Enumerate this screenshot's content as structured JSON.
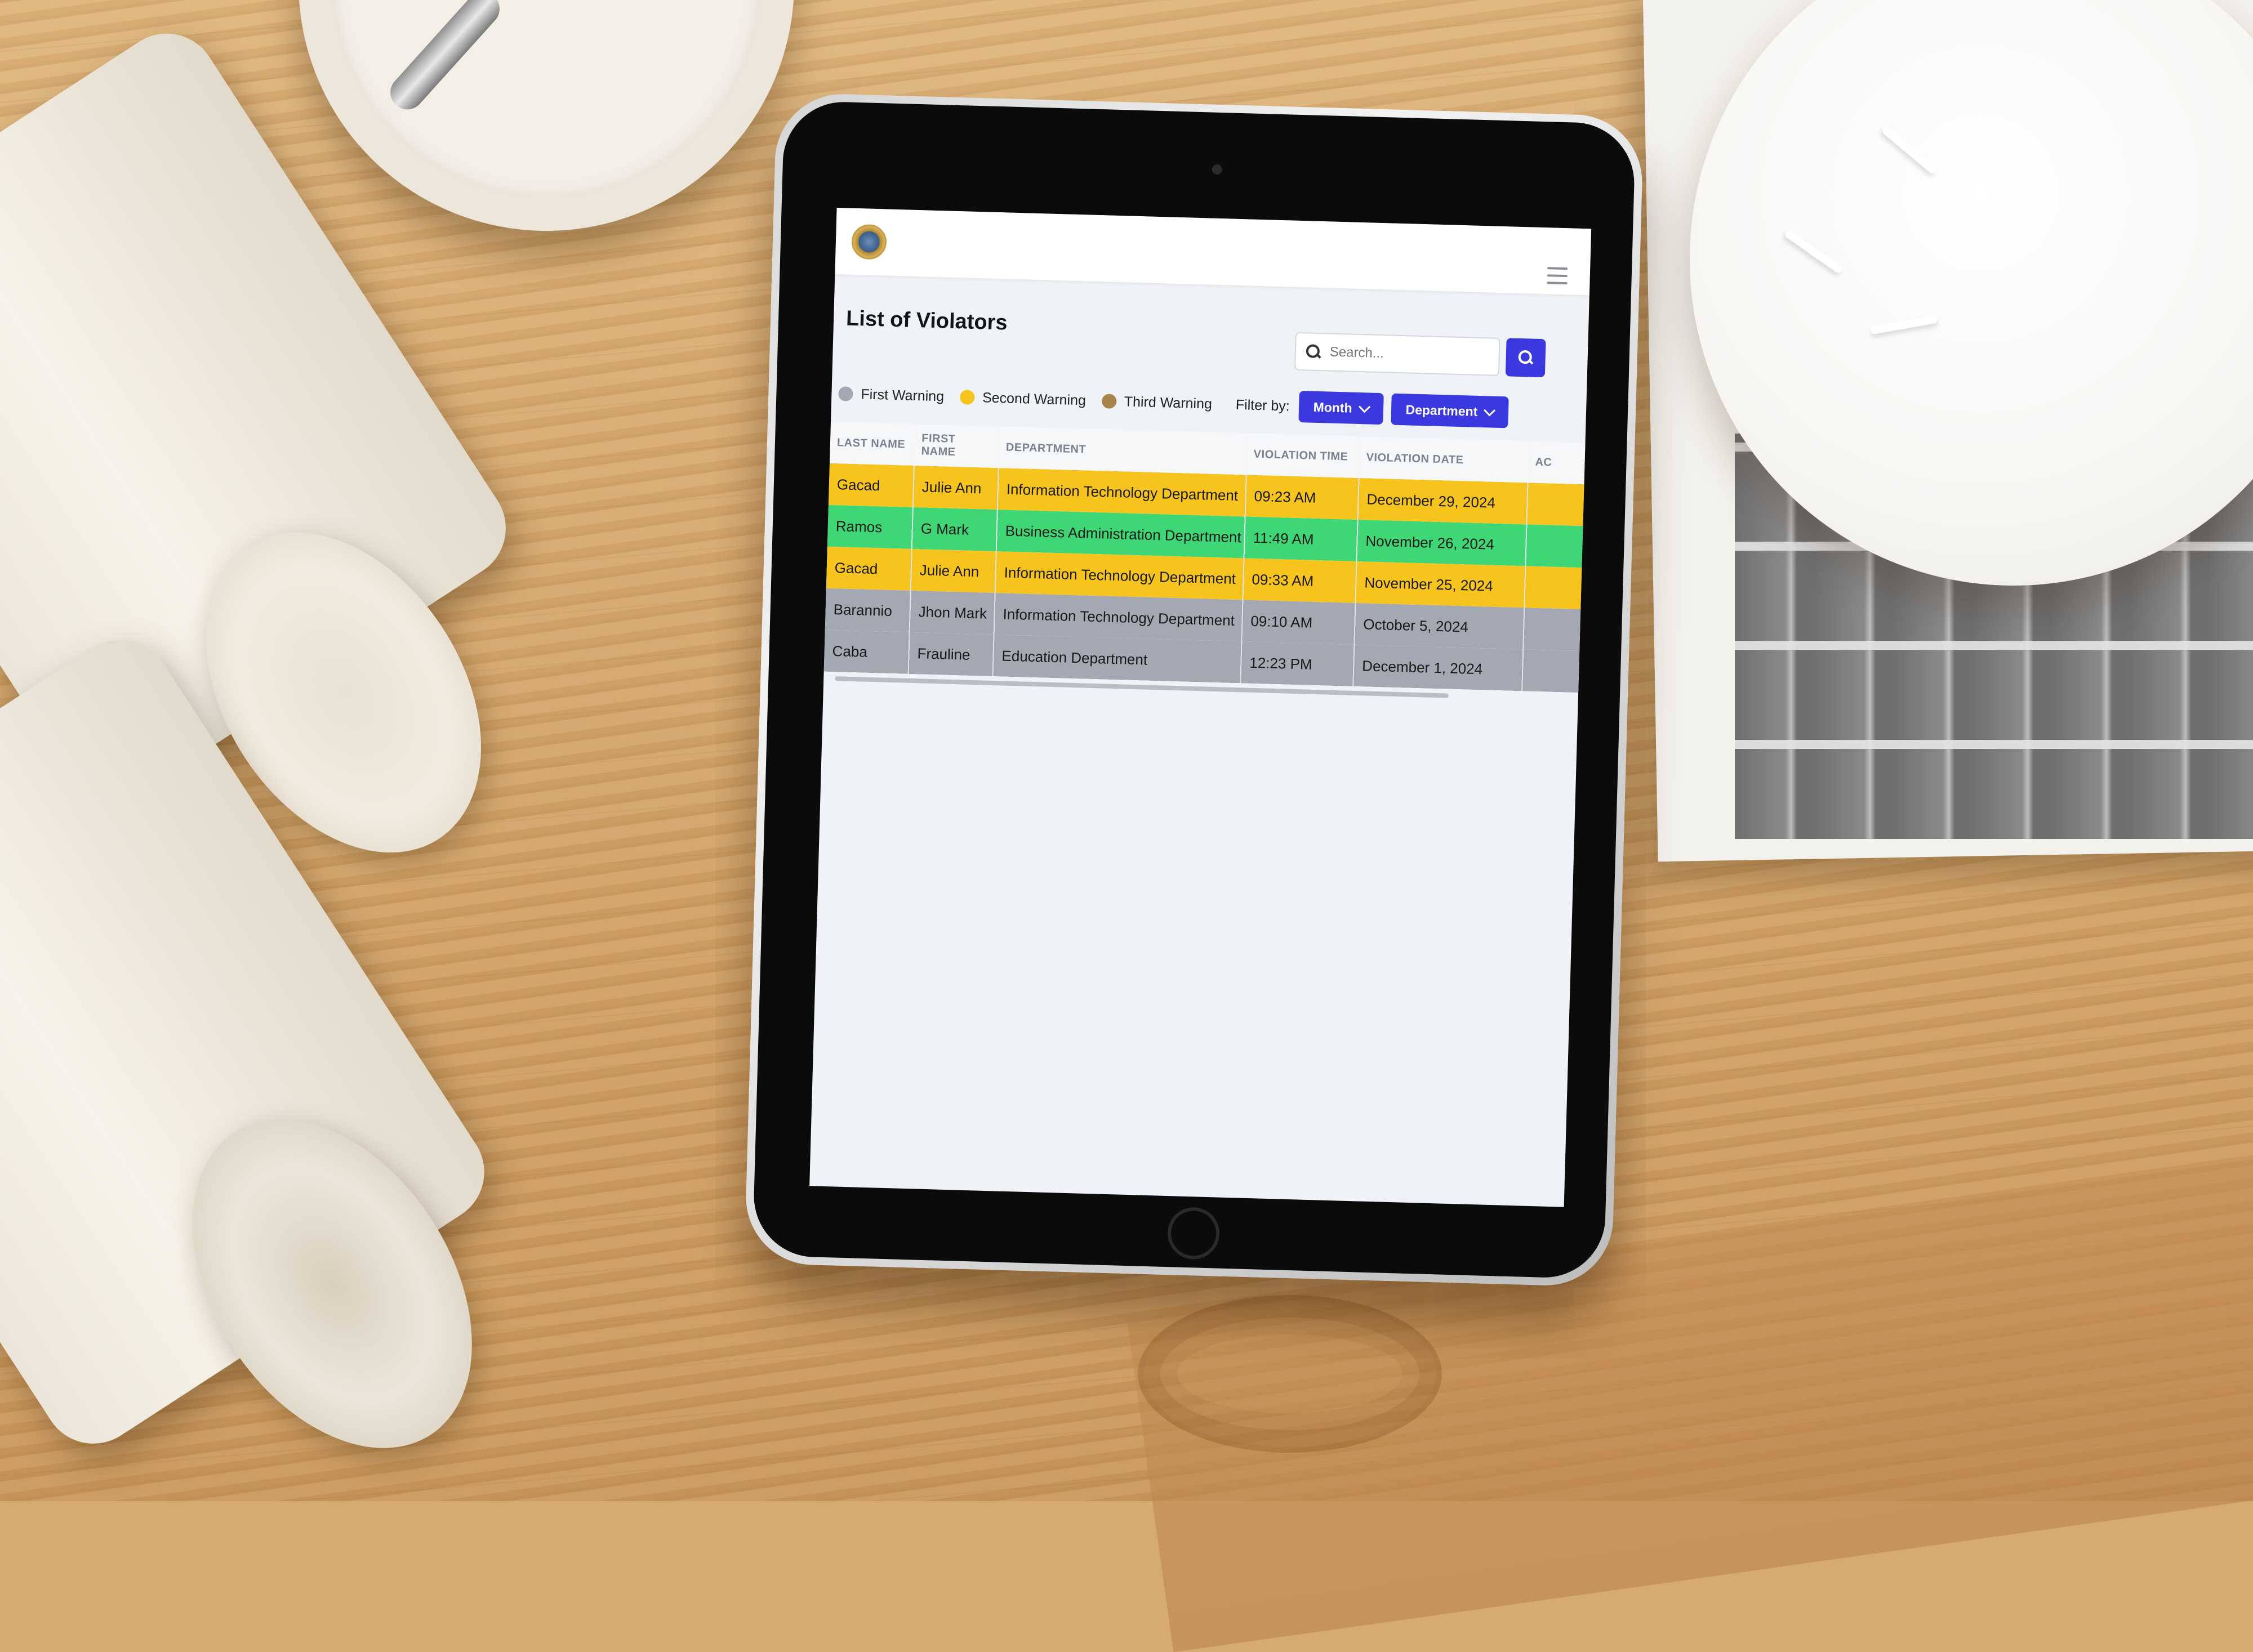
{
  "header": {
    "logo_icon": "seal-logo-icon",
    "menu_icon": "hamburger-menu-icon"
  },
  "page": {
    "title": "List of Violators"
  },
  "search": {
    "placeholder": "Search...",
    "value": "",
    "button_icon": "search-icon"
  },
  "legend": [
    {
      "label": "First Warning",
      "color": "#a3a8b2"
    },
    {
      "label": "Second Warning",
      "color": "#f7c31d"
    },
    {
      "label": "Third Warning",
      "color": "#a8844a"
    }
  ],
  "filters": {
    "label": "Filter by:",
    "month": "Month",
    "department": "Department"
  },
  "table": {
    "columns": [
      "LAST NAME",
      "FIRST NAME",
      "DEPARTMENT",
      "VIOLATION TIME",
      "VIOLATION DATE",
      "AC"
    ],
    "rows": [
      {
        "last": "Gacad",
        "first": "Julie Ann",
        "dept": "Information Technology Department",
        "time": "09:23 AM",
        "date": "December 29, 2024",
        "status": "Second Warning"
      },
      {
        "last": "Ramos",
        "first": "G Mark",
        "dept": "Business Administration Department",
        "time": "11:49 AM",
        "date": "November 26, 2024",
        "status": "green"
      },
      {
        "last": "Gacad",
        "first": "Julie Ann",
        "dept": "Information Technology Department",
        "time": "09:33 AM",
        "date": "November 25, 2024",
        "status": "Second Warning"
      },
      {
        "last": "Barannio",
        "first": "Jhon Mark",
        "dept": "Information Technology Department",
        "time": "09:10 AM",
        "date": "October 5, 2024",
        "status": "First Warning"
      },
      {
        "last": "Caba",
        "first": "Frauline",
        "dept": "Education Department",
        "time": "12:23 PM",
        "date": "December 1, 2024",
        "status": "First Warning"
      }
    ]
  }
}
